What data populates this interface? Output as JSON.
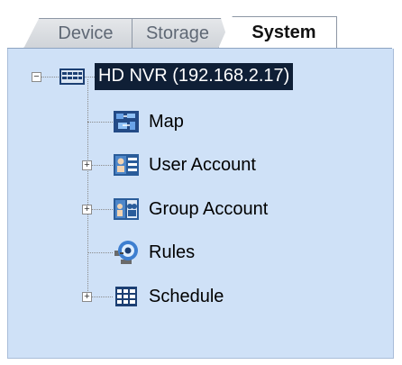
{
  "tabs": [
    {
      "label": "Device"
    },
    {
      "label": "Storage"
    },
    {
      "label": "System",
      "active": true
    }
  ],
  "tree": {
    "root": {
      "label": "HD NVR (192.168.2.17)",
      "icon": "nvr-icon",
      "expanded": true,
      "selected": true
    },
    "children": [
      {
        "label": "Map",
        "icon": "map-icon",
        "expandable": false
      },
      {
        "label": "User Account",
        "icon": "user-account-icon",
        "expandable": true
      },
      {
        "label": "Group Account",
        "icon": "group-account-icon",
        "expandable": true
      },
      {
        "label": "Rules",
        "icon": "rules-icon",
        "expandable": false
      },
      {
        "label": "Schedule",
        "icon": "schedule-icon",
        "expandable": true
      }
    ]
  },
  "colors": {
    "panel_background": "#cfe1f7",
    "selection_background": "#0f1f36"
  }
}
